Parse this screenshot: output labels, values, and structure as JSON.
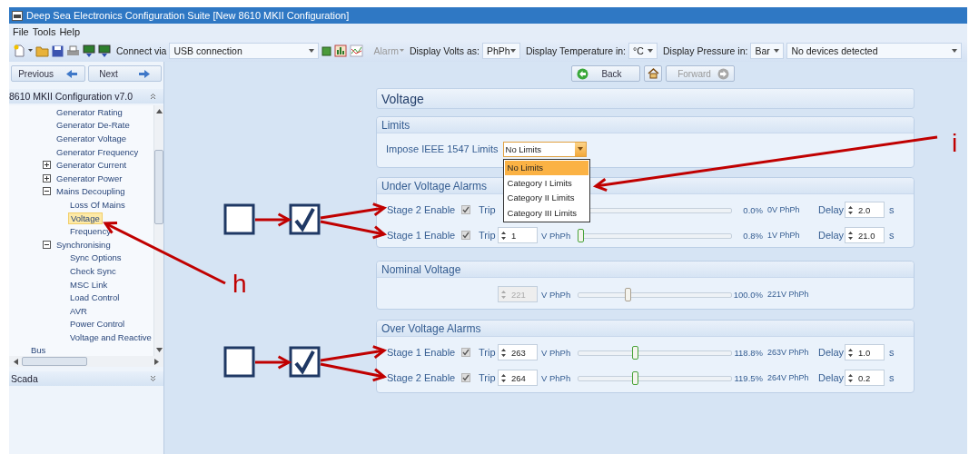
{
  "window": {
    "title": "Deep Sea Electronics Configuration Suite [New 8610 MKII Configuration]"
  },
  "menu": [
    "File",
    "Tools",
    "Help"
  ],
  "toolbar": {
    "connect_label": "Connect via",
    "connection": "USB connection",
    "alarm": {
      "label": "Alarm",
      "disabled": true
    },
    "volts_label": "Display Volts as:",
    "volts": "PhPh",
    "temperature_label": "Display Temperature in:",
    "temperature": "°C",
    "pressure_label": "Display Pressure in:",
    "pressure": "Bar",
    "device": "No devices detected"
  },
  "navigation": {
    "previous": "Previous",
    "next": "Next",
    "back": "Back",
    "forward": {
      "label": "Forward",
      "disabled": true
    }
  },
  "sidebar": {
    "title": "8610 MKII Configuration v7.0",
    "tree": [
      {
        "children": [
          {
            "label": "Generator Rating",
            "selected": false
          },
          {
            "label": "Generator De-Rate",
            "selected": false
          },
          {
            "label": "Generator Voltage",
            "selected": false
          },
          {
            "label": "Generator Frequency",
            "selected": false
          },
          {
            "label": "Generator Current",
            "selected": false,
            "expanded": false
          },
          {
            "label": "Generator Power",
            "selected": false,
            "expanded": false
          },
          {
            "label": "Mains Decoupling",
            "selected": false,
            "expanded": true,
            "children": [
              {
                "label": "Loss Of Mains",
                "selected": false
              },
              {
                "label": "Voltage",
                "selected": true
              },
              {
                "label": "Frequency",
                "selected": false
              }
            ]
          },
          {
            "label": "Synchronising",
            "selected": false,
            "expanded": true,
            "children": [
              {
                "label": "Sync Options",
                "selected": false
              },
              {
                "label": "Check Sync",
                "selected": false
              },
              {
                "label": "MSC Link",
                "selected": false
              },
              {
                "label": "Load Control",
                "selected": false
              },
              {
                "label": "AVR",
                "selected": false
              },
              {
                "label": "Power Control",
                "selected": false
              },
              {
                "label": "Voltage and Reactive",
                "selected": false
              }
            ]
          }
        ]
      },
      {
        "label": "Bus",
        "selected": false
      }
    ],
    "footer": "Scada"
  },
  "page": {
    "title": "Voltage",
    "limits": {
      "title": "Limits",
      "label": "Impose IEEE 1547 Limits",
      "value": "No Limits",
      "open": true,
      "options": [
        {
          "label": "No Limits",
          "selected": true
        },
        {
          "label": "Category I Limits",
          "selected": false
        },
        {
          "label": "Category II Limits",
          "selected": false
        },
        {
          "label": "Category III Limits",
          "selected": false
        }
      ]
    },
    "under_voltage": {
      "title": "Under Voltage Alarms",
      "rows": [
        {
          "label": "Stage 2 Enable",
          "checked": true,
          "trip_label": "Trip",
          "percent": "0.0%",
          "reading": "0V PhPh",
          "delay_label": "Delay",
          "delay": "2.0",
          "delay_unit": "s"
        },
        {
          "label": "Stage 1 Enable",
          "checked": true,
          "trip_label": "Trip",
          "trip": "1",
          "unit": "V PhPh",
          "level": 0.0,
          "percent": "0.8%",
          "reading": "1V PhPh",
          "delay_label": "Delay",
          "delay": "21.0",
          "delay_unit": "s"
        }
      ]
    },
    "nominal_voltage": {
      "title": "Nominal Voltage",
      "value": "221",
      "disabled": true,
      "unit": "V PhPh",
      "level": 0.32,
      "percent": "100.0%",
      "reading": "221V PhPh"
    },
    "over_voltage": {
      "title": "Over Voltage Alarms",
      "rows": [
        {
          "label": "Stage 1 Enable",
          "checked": true,
          "trip_label": "Trip",
          "trip": "263",
          "unit": "V PhPh",
          "level": 0.37,
          "percent": "118.8%",
          "reading": "263V PhPh",
          "delay_label": "Delay",
          "delay": "1.0",
          "delay_unit": "s"
        },
        {
          "label": "Stage 2 Enable",
          "checked": true,
          "trip_label": "Trip",
          "trip": "264",
          "unit": "V PhPh",
          "level": 0.37,
          "percent": "119.5%",
          "reading": "264V PhPh",
          "delay_label": "Delay",
          "delay": "0.2",
          "delay_unit": "s"
        }
      ]
    }
  },
  "annotations": [
    {
      "kind": "letter",
      "text": "h"
    },
    {
      "kind": "letter",
      "text": "i"
    }
  ]
}
